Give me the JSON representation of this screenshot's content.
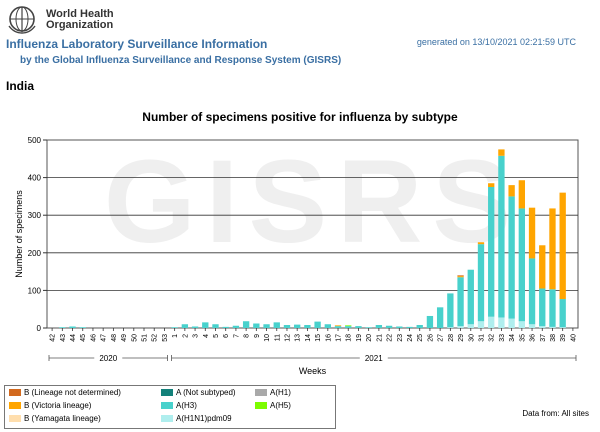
{
  "header": {
    "logo_line1": "World Health",
    "logo_line2": "Organization",
    "title": "Influenza Laboratory Surveillance Information",
    "subtitle": "by the Global Influenza Surveillance and Response System (GISRS)",
    "generated": "generated on 13/10/2021 02:21:59 UTC",
    "country": "India",
    "watermark": "GISRS"
  },
  "legend": {
    "items": [
      {
        "label": "B (Lineage not determined)",
        "color": "#d2691e"
      },
      {
        "label": "A (Not subtyped)",
        "color": "#13817a"
      },
      {
        "label": "A(H1)",
        "color": "#a9a9a9"
      },
      {
        "label": "B (Victoria lineage)",
        "color": "#ffa500"
      },
      {
        "label": "A(H3)",
        "color": "#48d1cc"
      },
      {
        "label": "A(H5)",
        "color": "#7cfc00"
      },
      {
        "label": "B (Yamagata lineage)",
        "color": "#ffdead"
      },
      {
        "label": "A(H1N1)pdm09",
        "color": "#afeeee"
      }
    ]
  },
  "footer": {
    "data_from": "Data from: All sites"
  },
  "chart_data": {
    "type": "bar",
    "stacked": true,
    "title": "Number of specimens positive for influenza by subtype",
    "xlabel": "Weeks",
    "ylabel": "Number of specimens",
    "ylim": [
      0,
      500
    ],
    "yticks": [
      0,
      100,
      200,
      300,
      400,
      500
    ],
    "grid": true,
    "year_labels": [
      {
        "label": "2020",
        "from": 0,
        "to": 11
      },
      {
        "label": "2021",
        "from": 12,
        "to": 51
      }
    ],
    "categories": [
      "42",
      "43",
      "44",
      "45",
      "46",
      "47",
      "48",
      "49",
      "50",
      "51",
      "52",
      "53",
      "1",
      "2",
      "3",
      "4",
      "5",
      "6",
      "7",
      "8",
      "9",
      "10",
      "11",
      "12",
      "13",
      "14",
      "15",
      "16",
      "17",
      "18",
      "19",
      "20",
      "21",
      "22",
      "23",
      "24",
      "25",
      "26",
      "27",
      "28",
      "29",
      "30",
      "31",
      "32",
      "33",
      "34",
      "35",
      "36",
      "37",
      "38",
      "39",
      "40"
    ],
    "series": [
      {
        "name": "A(H1N1)pdm09",
        "color": "#afeeee",
        "values": [
          0,
          0,
          0,
          0,
          0,
          0,
          0,
          0,
          0,
          0,
          0,
          0,
          0,
          0,
          0,
          0,
          0,
          0,
          0,
          0,
          0,
          0,
          0,
          0,
          0,
          0,
          0,
          0,
          0,
          0,
          0,
          0,
          0,
          0,
          0,
          0,
          0,
          0,
          0,
          2,
          5,
          10,
          18,
          30,
          28,
          25,
          18,
          10,
          5,
          3,
          2,
          0
        ]
      },
      {
        "name": "A(H3)",
        "color": "#48d1cc",
        "values": [
          0,
          2,
          4,
          2,
          0,
          0,
          0,
          0,
          0,
          0,
          0,
          0,
          2,
          10,
          4,
          15,
          10,
          3,
          6,
          18,
          12,
          10,
          15,
          8,
          9,
          8,
          17,
          10,
          5,
          5,
          5,
          2,
          8,
          6,
          4,
          3,
          8,
          32,
          55,
          90,
          130,
          145,
          205,
          345,
          430,
          325,
          300,
          175,
          100,
          100,
          75,
          0
        ]
      },
      {
        "name": "A(H5)",
        "color": "#7cfc00",
        "values": [
          0,
          0,
          0,
          0,
          0,
          0,
          0,
          0,
          0,
          0,
          0,
          0,
          0,
          0,
          0,
          0,
          0,
          0,
          0,
          0,
          0,
          0,
          0,
          0,
          0,
          0,
          0,
          0,
          0,
          2,
          0,
          0,
          0,
          0,
          0,
          0,
          0,
          0,
          0,
          0,
          0,
          0,
          0,
          0,
          0,
          0,
          0,
          0,
          0,
          0,
          0,
          0
        ]
      },
      {
        "name": "B (Victoria lineage)",
        "color": "#ffa500",
        "values": [
          0,
          0,
          0,
          0,
          0,
          0,
          0,
          0,
          0,
          0,
          0,
          0,
          0,
          0,
          0,
          0,
          0,
          0,
          0,
          0,
          0,
          0,
          0,
          0,
          0,
          0,
          0,
          0,
          2,
          0,
          0,
          0,
          0,
          0,
          0,
          0,
          0,
          0,
          0,
          0,
          3,
          0,
          5,
          10,
          17,
          30,
          75,
          135,
          115,
          215,
          283,
          0
        ]
      },
      {
        "name": "B (Lineage not determined)",
        "color": "#d2691e",
        "values": [
          0,
          0,
          0,
          0,
          0,
          0,
          0,
          0,
          0,
          0,
          0,
          0,
          0,
          0,
          0,
          0,
          0,
          0,
          0,
          0,
          0,
          0,
          0,
          0,
          0,
          0,
          0,
          0,
          0,
          0,
          0,
          0,
          0,
          0,
          0,
          0,
          0,
          0,
          0,
          0,
          2,
          0,
          0,
          0,
          0,
          0,
          0,
          0,
          0,
          0,
          0,
          0
        ]
      }
    ]
  }
}
